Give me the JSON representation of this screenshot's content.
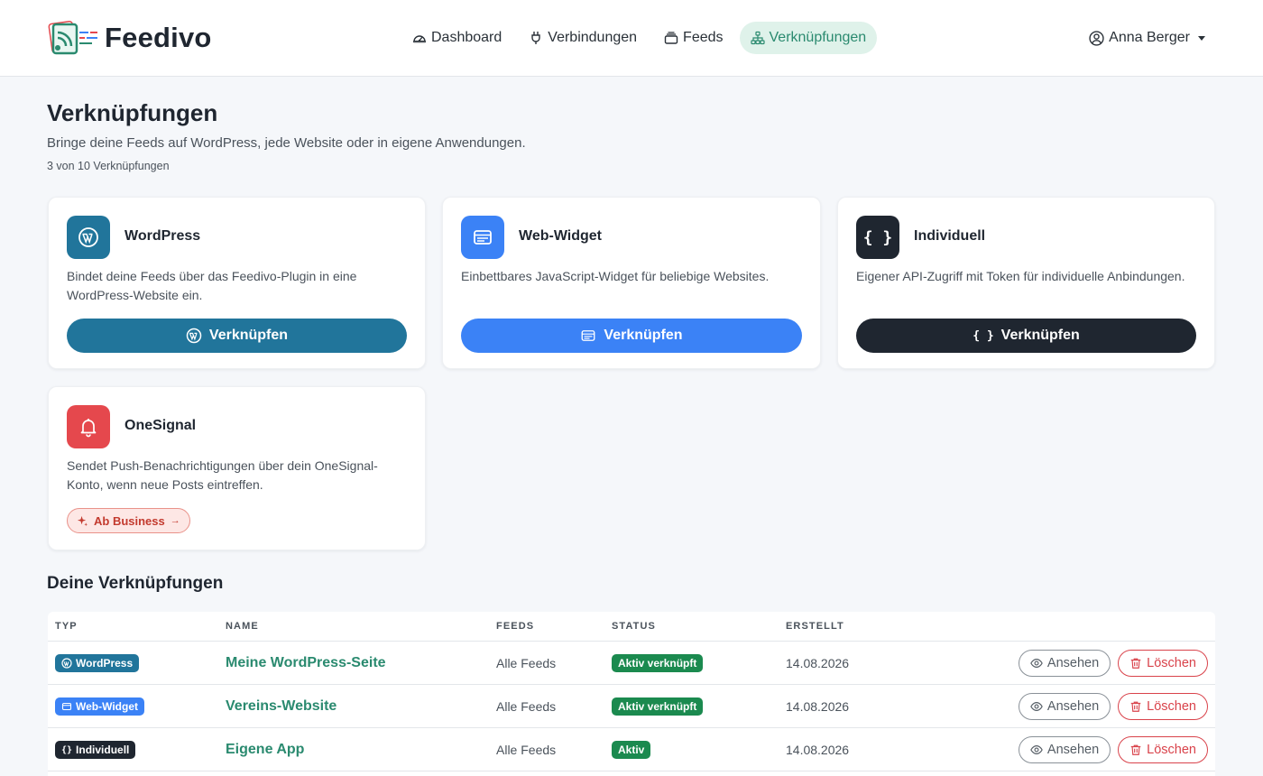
{
  "app": {
    "name": "Feedivo"
  },
  "nav": {
    "items": [
      {
        "label": "Dashboard",
        "icon": "gauge-icon"
      },
      {
        "label": "Verbindungen",
        "icon": "plug-icon"
      },
      {
        "label": "Feeds",
        "icon": "stack-icon"
      },
      {
        "label": "Verknüpfungen",
        "icon": "sitemap-icon",
        "active": true
      }
    ]
  },
  "user": {
    "name": "Anna Berger",
    "icon": "user-circle-icon"
  },
  "page": {
    "title": "Verknüpfungen",
    "subtitle": "Bringe deine Feeds auf WordPress, jede Website oder in eigene Anwendungen.",
    "count": "3 von 10 Verknüpfungen"
  },
  "integrations": [
    {
      "title": "WordPress",
      "description": "Bindet deine Feeds über das Feedivo-Plugin in eine WordPress-Website ein.",
      "button": "Verknüpfen",
      "color": "#21759b",
      "icon": "wordpress-icon"
    },
    {
      "title": "Web-Widget",
      "description": "Einbettbares JavaScript-Widget für beliebige Websites.",
      "button": "Verknüpfen",
      "color": "#3b82f6",
      "icon": "window-icon"
    },
    {
      "title": "Individuell",
      "description": "Eigener API-Zugriff mit Token für individuelle Anbindungen.",
      "button": "Verknüpfen",
      "color": "#1f2630",
      "icon": "braces-icon"
    },
    {
      "title": "OneSignal",
      "description": "Sendet Push-Benachrichtigungen über dein OneSignal-Konto, wenn neue Posts eintreffen.",
      "button": "Ab Business",
      "color": "#e5484d",
      "icon": "bell-icon"
    }
  ],
  "table": {
    "title": "Deine Verknüpfungen",
    "columns": [
      "TYP",
      "NAME",
      "FEEDS",
      "STATUS",
      "ERSTELLT"
    ],
    "rows": [
      {
        "type": "WordPress",
        "type_color": "#21759b",
        "type_icon": "wordpress-icon",
        "name": "Meine WordPress-Seite",
        "feeds": "Alle Feeds",
        "status": "Aktiv verknüpft",
        "created": "14.08.2026",
        "view": "Ansehen",
        "delete": "Löschen"
      },
      {
        "type": "Web-Widget",
        "type_color": "#3b82f6",
        "type_icon": "window-icon",
        "name": "Vereins-Website",
        "feeds": "Alle Feeds",
        "status": "Aktiv verknüpft",
        "created": "14.08.2026",
        "view": "Ansehen",
        "delete": "Löschen"
      },
      {
        "type": "Individuell",
        "type_color": "#1f2630",
        "type_icon": "braces-icon",
        "name": "Eigene App",
        "feeds": "Alle Feeds",
        "status": "Aktiv",
        "created": "14.08.2026",
        "view": "Ansehen",
        "delete": "Löschen"
      }
    ]
  },
  "colors": {
    "accent": "#2a8a6f",
    "status_green": "#1b8a4f",
    "danger": "#d9434b"
  }
}
